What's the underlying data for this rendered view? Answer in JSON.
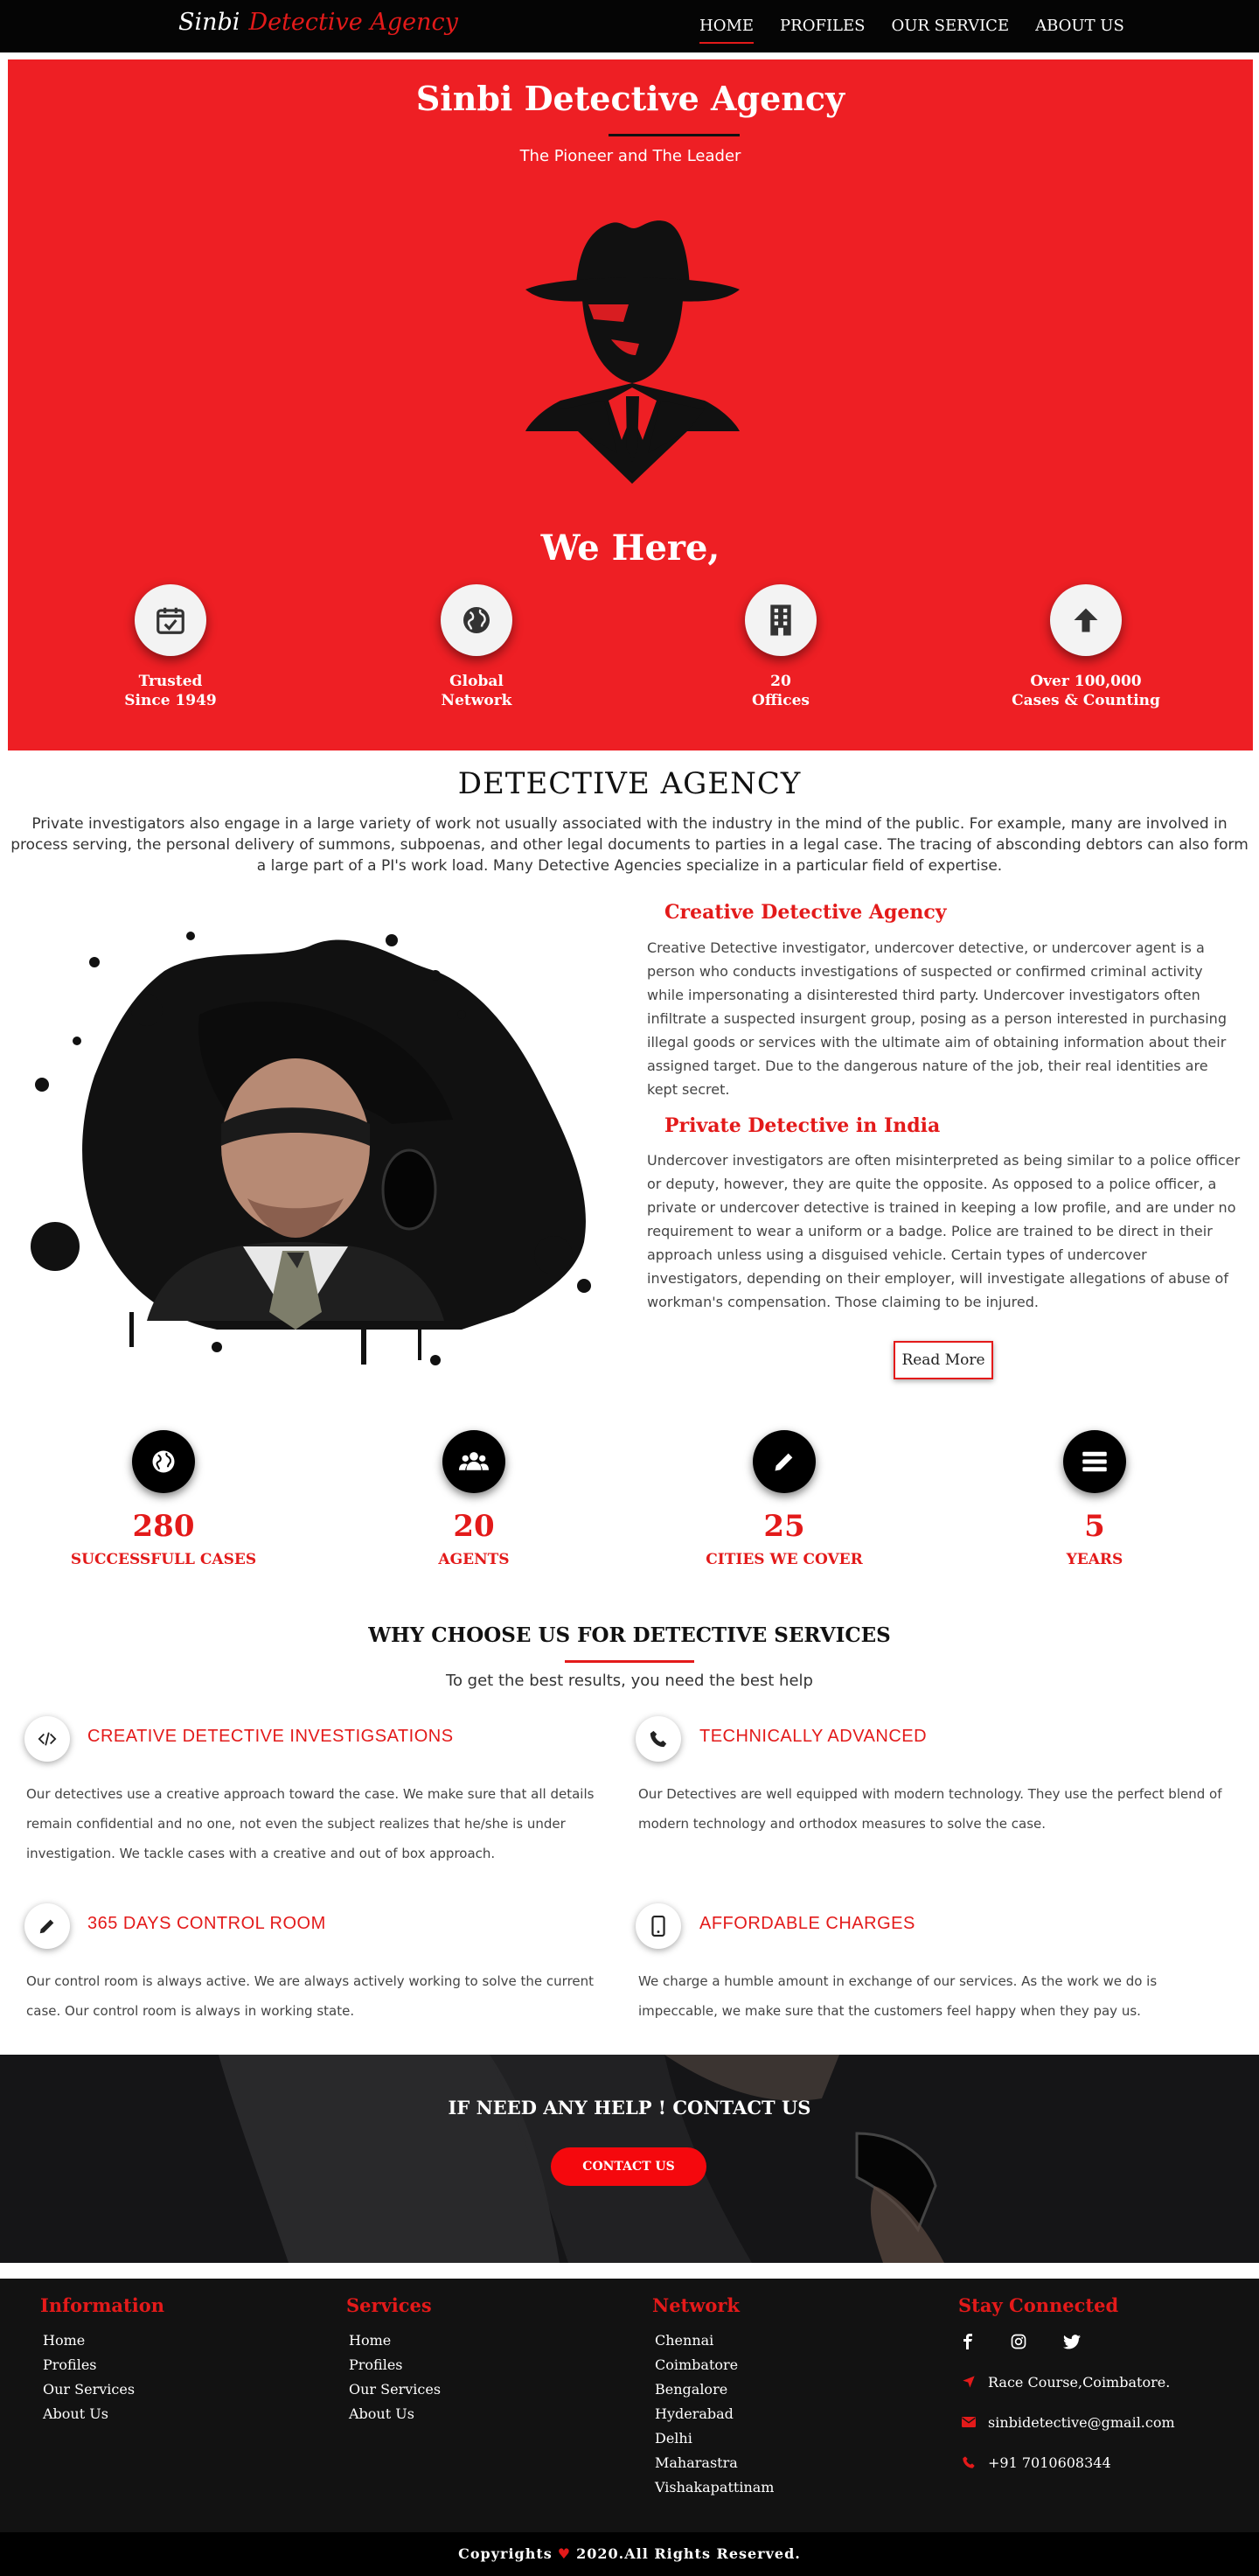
{
  "nav": {
    "brand_first": "Sinbi",
    "brand_second": "Detective Agency",
    "items": [
      "HOME",
      "PROFILES",
      "OUR SERVICE",
      "ABOUT US"
    ]
  },
  "hero": {
    "title": "Sinbi Detective Agency",
    "subtitle": "The Pioneer and The Leader",
    "we_here": "We Here,",
    "features": [
      {
        "icon": "calendar-check-icon",
        "line1": "Trusted",
        "line2": "Since 1949"
      },
      {
        "icon": "globe-icon",
        "line1": "Global",
        "line2": "Network"
      },
      {
        "icon": "building-icon",
        "line1": "20",
        "line2": "Offices"
      },
      {
        "icon": "arrow-up-icon",
        "line1": "Over 100,000",
        "line2": "Cases & Counting"
      }
    ]
  },
  "intro": {
    "title": "DETECTIVE AGENCY",
    "text": "Private investigators also engage in a large variety of work not usually associated with the industry in the mind of the public. For example, many are involved in process serving, the personal delivery of summons, subpoenas, and other legal documents to parties in a legal case. The tracing of absconding debtors can also form a large part of a PI's work load. Many Detective Agencies specialize in a particular field of expertise."
  },
  "about": {
    "h1": "Creative Detective Agency",
    "p1": "Creative Detective investigator, undercover detective, or undercover agent is a person who conducts investigations of suspected or confirmed criminal activity while impersonating a disinterested third party. Undercover investigators often infiltrate a suspected insurgent group, posing as a person interested in purchasing illegal goods or services with the ultimate aim of obtaining information about their assigned target. Due to the dangerous nature of the job, their real identities are kept secret.",
    "h2": "Private Detective in India",
    "p2": "Undercover investigators are often misinterpreted as being similar to a police officer or deputy, however, they are quite the opposite. As opposed to a police officer, a private or undercover detective is trained in keeping a low profile, and are under no requirement to wear a uniform or a badge. Police are trained to be direct in their approach unless using a disguised vehicle. Certain types of undercover investigators, depending on their employer, will investigate allegations of abuse of workman's compensation. Those claiming to be injured.",
    "read_more": "Read More"
  },
  "stats": [
    {
      "icon": "globe-icon",
      "value": "280",
      "label": "SUCCESSFULL CASES"
    },
    {
      "icon": "users-icon",
      "value": "20",
      "label": "AGENTS"
    },
    {
      "icon": "pencil-icon",
      "value": "25",
      "label": "CITIES WE COVER"
    },
    {
      "icon": "menu-icon",
      "value": "5",
      "label": "YEARS"
    }
  ],
  "why": {
    "title": "WHY CHOOSE US FOR DETECTIVE SERVICES",
    "subtitle": "To get the best results, you need the best help",
    "services": [
      {
        "icon": "code-icon",
        "title": "CREATIVE DETECTIVE INVESTIGSATIONS",
        "text": "Our detectives use a creative approach toward the case. We make sure that all details remain confidential and no one, not even the subject realizes that he/she is under investigation. We tackle cases with a creative and out of box approach."
      },
      {
        "icon": "phone-icon",
        "title": "TECHNICALLY ADVANCED",
        "text": "Our Detectives are well equipped with modern technology. They use the perfect blend of modern technology and orthodox measures to solve the case."
      },
      {
        "icon": "pencil-icon",
        "title": "365 DAYS CONTROL ROOM",
        "text": "Our control room is always active. We are always actively working to solve the current case. Our control room is always in working state."
      },
      {
        "icon": "mobile-icon",
        "title": "AFFORDABLE CHARGES",
        "text": "We charge a humble amount in exchange of our services. As the work we do is impeccable, we make sure that the customers feel happy when they pay us."
      }
    ]
  },
  "cta": {
    "title": "IF NEED ANY HELP ! CONTACT US",
    "button": "CONTACT US"
  },
  "footer": {
    "information": {
      "title": "Information",
      "items": [
        "Home",
        "Profiles",
        "Our Services",
        "About Us"
      ]
    },
    "services": {
      "title": "Services",
      "items": [
        "Home",
        "Profiles",
        "Our Services",
        "About Us"
      ]
    },
    "network": {
      "title": "Network",
      "items": [
        "Chennai",
        "Coimbatore",
        "Bengalore",
        "Hyderabad",
        "Delhi",
        "Maharastra",
        "Vishakapattinam"
      ]
    },
    "stay": {
      "title": "Stay Connected",
      "address": "Race Course,Coimbatore.",
      "email": "sinbidetective@gmail.com",
      "phone": "+91 7010608344"
    },
    "copyright_pre": "Copyrights",
    "heart": "♥",
    "copyright_post": "2020.All Rights Reserved."
  },
  "colors": {
    "accent": "#e31a1a",
    "hero_bg": "#ee1f24",
    "dark": "#050505"
  }
}
